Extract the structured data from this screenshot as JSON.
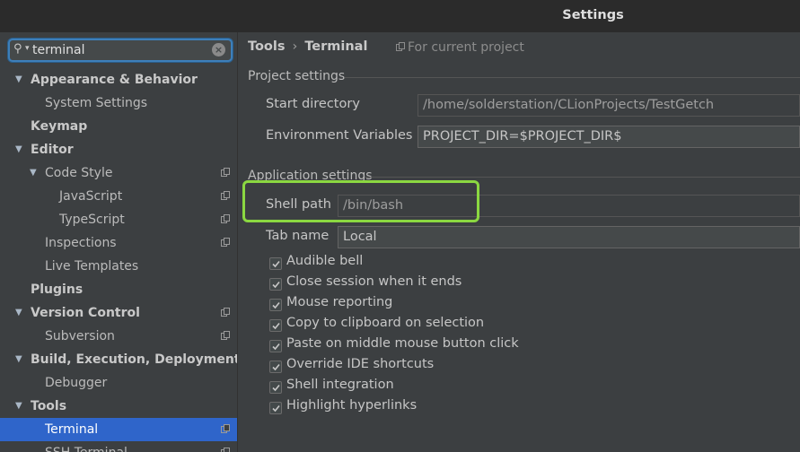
{
  "window": {
    "title": "Settings"
  },
  "search": {
    "value": "terminal"
  },
  "sidebar": {
    "items": [
      {
        "label": "Appearance & Behavior",
        "level": 0,
        "arrow": true,
        "bold": true,
        "proj": false
      },
      {
        "label": "System Settings",
        "level": 1,
        "arrow": false,
        "bold": false,
        "proj": false
      },
      {
        "label": "Keymap",
        "level": 0,
        "arrow": false,
        "bold": true,
        "proj": false
      },
      {
        "label": "Editor",
        "level": 0,
        "arrow": true,
        "bold": true,
        "proj": false
      },
      {
        "label": "Code Style",
        "level": 1,
        "arrow": true,
        "bold": false,
        "proj": true
      },
      {
        "label": "JavaScript",
        "level": 2,
        "arrow": false,
        "bold": false,
        "proj": true
      },
      {
        "label": "TypeScript",
        "level": 2,
        "arrow": false,
        "bold": false,
        "proj": true
      },
      {
        "label": "Inspections",
        "level": 1,
        "arrow": false,
        "bold": false,
        "proj": true
      },
      {
        "label": "Live Templates",
        "level": 1,
        "arrow": false,
        "bold": false,
        "proj": false
      },
      {
        "label": "Plugins",
        "level": 0,
        "arrow": false,
        "bold": true,
        "proj": false
      },
      {
        "label": "Version Control",
        "level": 0,
        "arrow": true,
        "bold": true,
        "proj": true
      },
      {
        "label": "Subversion",
        "level": 1,
        "arrow": false,
        "bold": false,
        "proj": true
      },
      {
        "label": "Build, Execution, Deployment",
        "level": 0,
        "arrow": true,
        "bold": true,
        "proj": false
      },
      {
        "label": "Debugger",
        "level": 1,
        "arrow": false,
        "bold": false,
        "proj": false
      },
      {
        "label": "Tools",
        "level": 0,
        "arrow": true,
        "bold": true,
        "proj": false
      },
      {
        "label": "Terminal",
        "level": 1,
        "arrow": false,
        "bold": false,
        "proj": true,
        "selected": true
      },
      {
        "label": "SSH Terminal",
        "level": 1,
        "arrow": false,
        "bold": false,
        "proj": true
      }
    ]
  },
  "breadcrumb": {
    "parent": "Tools",
    "separator": "›",
    "current": "Terminal",
    "for_project": "For current project"
  },
  "project_settings": {
    "heading": "Project settings",
    "start_directory_label": "Start directory",
    "start_directory_value": "/home/solderstation/CLionProjects/TestGetch",
    "env_label": "Environment Variables",
    "env_value": "PROJECT_DIR=$PROJECT_DIR$"
  },
  "app_settings": {
    "heading": "Application settings",
    "shell_path_label": "Shell path",
    "shell_path_value": "/bin/bash",
    "tab_name_label": "Tab name",
    "tab_name_value": "Local",
    "checkboxes": [
      {
        "label": "Audible bell",
        "checked": true
      },
      {
        "label": "Close session when it ends",
        "checked": true
      },
      {
        "label": "Mouse reporting",
        "checked": true
      },
      {
        "label": "Copy to clipboard on selection",
        "checked": true
      },
      {
        "label": "Paste on middle mouse button click",
        "checked": true
      },
      {
        "label": "Override IDE shortcuts",
        "checked": true
      },
      {
        "label": "Shell integration",
        "checked": true
      },
      {
        "label": "Highlight hyperlinks",
        "checked": true
      }
    ]
  },
  "colors": {
    "accent": "#2f65ca",
    "highlight_box": "#8bd841",
    "search_focus": "#3d7fba"
  }
}
